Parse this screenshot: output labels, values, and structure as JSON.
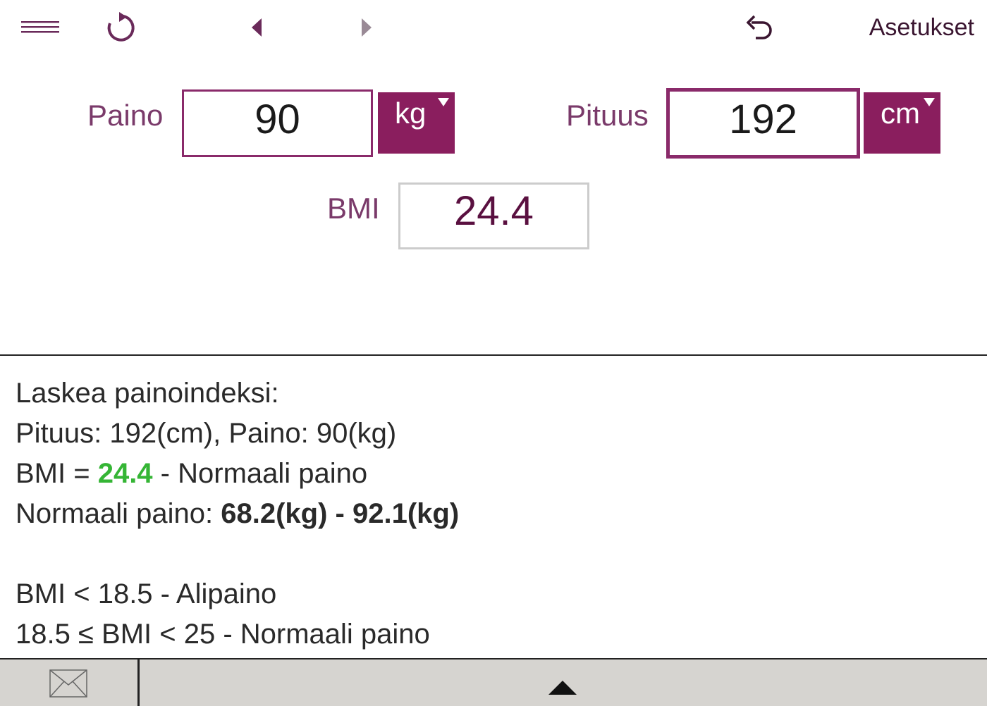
{
  "toolbar": {
    "menu_icon": "hamburger-icon",
    "refresh_icon": "refresh-icon",
    "back_icon": "triangle-left-icon",
    "forward_icon": "triangle-right-icon",
    "undo_icon": "undo-icon",
    "settings_label": "Asetukset"
  },
  "inputs": {
    "weight_label": "Paino",
    "weight_value": "90",
    "weight_unit": "kg",
    "height_label": "Pituus",
    "height_value": "192",
    "height_unit": "cm",
    "bmi_label": "BMI",
    "bmi_value": "24.4"
  },
  "results": {
    "heading": "Laskea painoindeksi:",
    "summary": "Pituus: 192(cm), Paino: 90(kg)",
    "bmi_prefix": "BMI = ",
    "bmi_value": "24.4",
    "bmi_suffix": " - Normaali paino",
    "normal_prefix": "Normaali paino: ",
    "normal_range": "68.2(kg) - 92.1(kg)",
    "scale_1": "BMI < 18.5 - Alipaino",
    "scale_2": "18.5 ≤ BMI < 25 - Normaali paino"
  },
  "bottom": {
    "mail_icon": "envelope-icon",
    "expand_icon": "triangle-up-icon"
  },
  "colors": {
    "accent": "#8a1e5e",
    "label": "#7a3a6a",
    "bmi_highlight": "#35b535",
    "bottom_bar": "#d6d4d0"
  }
}
